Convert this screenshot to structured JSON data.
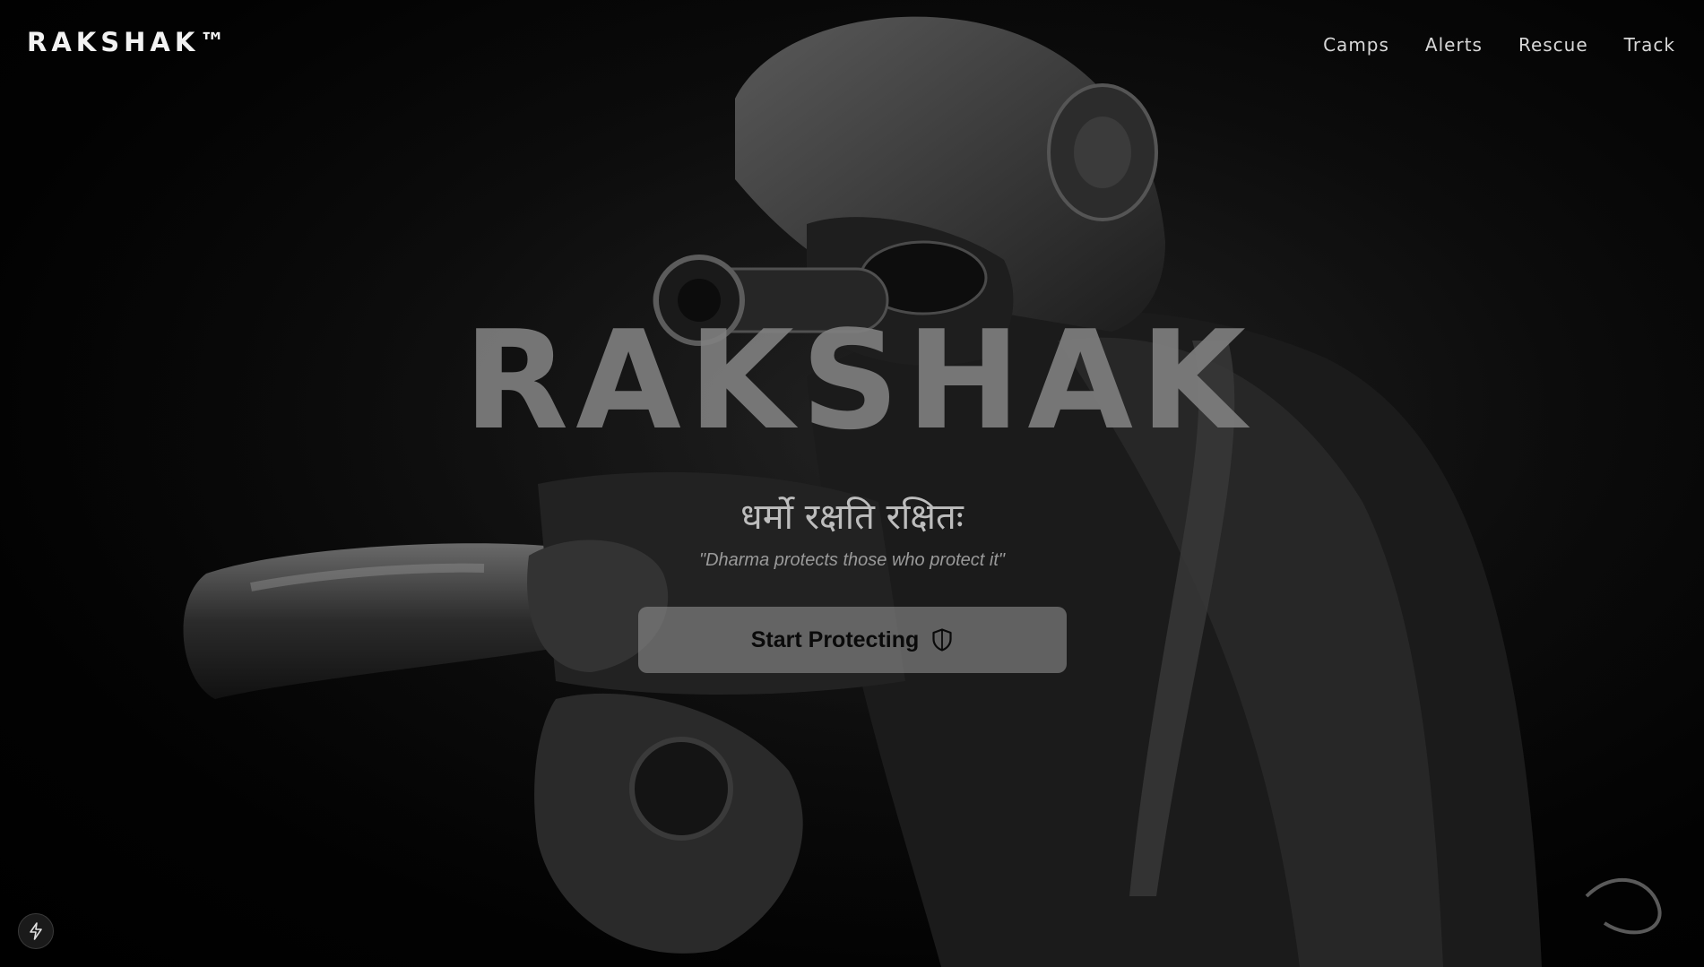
{
  "nav": {
    "brand": "RAKSHAK™",
    "links": [
      {
        "label": "Camps"
      },
      {
        "label": "Alerts"
      },
      {
        "label": "Rescue"
      },
      {
        "label": "Track"
      }
    ]
  },
  "hero": {
    "title": "RAKSHAK",
    "motto": "धर्मो रक्षति रक्षितः",
    "translation": "\"Dharma protects those who protect it\"",
    "cta_label": "Start Protecting",
    "cta_icon": "shield-icon"
  },
  "background": {
    "subject": "soldier-aiming-rifle-illustration"
  },
  "corner": {
    "icon": "bolt-icon"
  },
  "colors": {
    "background": "#000000",
    "text": "#f2f2f2",
    "title": "#808080",
    "button": "#8c8c8c"
  }
}
